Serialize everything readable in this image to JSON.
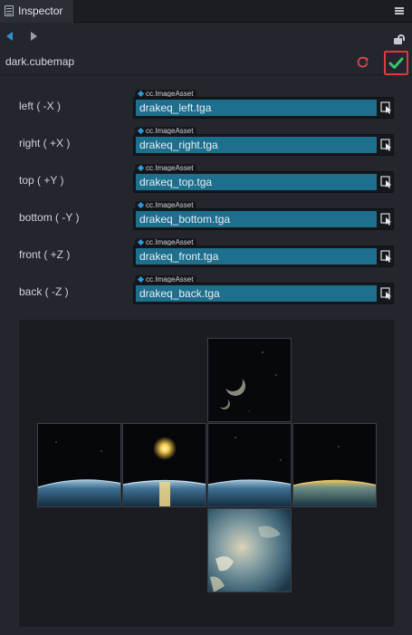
{
  "panel": {
    "tab_title": "Inspector"
  },
  "asset": {
    "name": "dark.cubemap"
  },
  "properties": [
    {
      "label": "left ( -X )",
      "type": "cc.ImageAsset",
      "value": "drakeq_left.tga"
    },
    {
      "label": "right ( +X )",
      "type": "cc.ImageAsset",
      "value": "drakeq_right.tga"
    },
    {
      "label": "top ( +Y )",
      "type": "cc.ImageAsset",
      "value": "drakeq_top.tga"
    },
    {
      "label": "bottom ( -Y )",
      "type": "cc.ImageAsset",
      "value": "drakeq_bottom.tga"
    },
    {
      "label": "front ( +Z )",
      "type": "cc.ImageAsset",
      "value": "drakeq_front.tga"
    },
    {
      "label": "back ( -Z )",
      "type": "cc.ImageAsset",
      "value": "drakeq_back.tga"
    }
  ],
  "colors": {
    "nav_accent": "#2f8fd6",
    "apply_check": "#37c46b",
    "apply_highlight_border": "#e03a3a",
    "revert": "#e2474b",
    "field_value_bg": "#1d6f8d"
  }
}
